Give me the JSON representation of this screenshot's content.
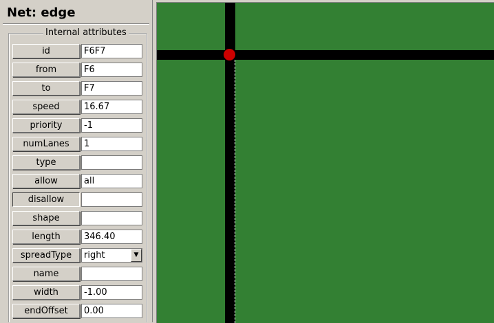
{
  "panel": {
    "title": "Net: edge",
    "group_label": "Internal attributes",
    "attributes": [
      {
        "label": "id",
        "value": "F6F7"
      },
      {
        "label": "from",
        "value": "F6"
      },
      {
        "label": "to",
        "value": "F7"
      },
      {
        "label": "speed",
        "value": "16.67"
      },
      {
        "label": "priority",
        "value": "-1"
      },
      {
        "label": "numLanes",
        "value": "1"
      },
      {
        "label": "type",
        "value": ""
      },
      {
        "label": "allow",
        "value": "all"
      },
      {
        "label": "disallow",
        "value": ""
      },
      {
        "label": "shape",
        "value": ""
      },
      {
        "label": "length",
        "value": "346.40"
      },
      {
        "label": "spreadType",
        "value": "right"
      },
      {
        "label": "name",
        "value": ""
      },
      {
        "label": "width",
        "value": "-1.00"
      },
      {
        "label": "endOffset",
        "value": "0.00"
      }
    ]
  },
  "canvas": {
    "background_color": "#338033",
    "road_color": "#000000",
    "junction_color": "#cc0000"
  }
}
